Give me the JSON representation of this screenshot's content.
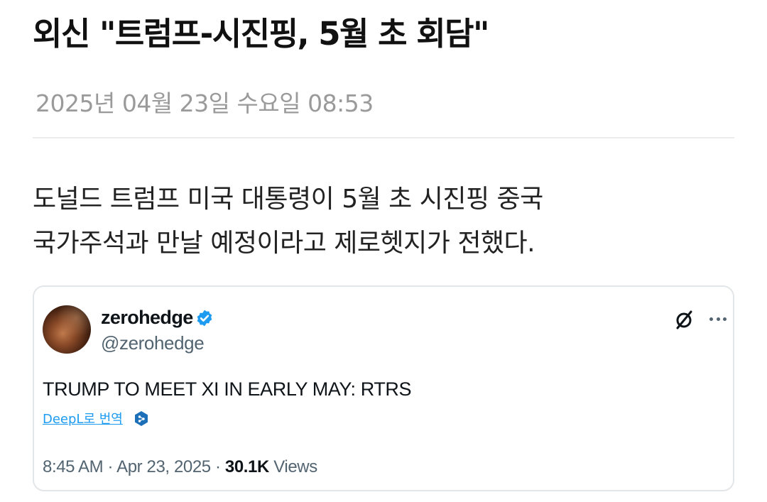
{
  "article": {
    "headline": "외신 \"트럼프-시진핑, 5월 초 회담\"",
    "dateline": "2025년 04월 23일 수요일 08:53",
    "body_line1": "도널드 트럼프 미국 대통령이 5월 초 시진핑 중국",
    "body_line2": "국가주석과 만날 예정이라고 제로헷지가 전했다."
  },
  "tweet": {
    "display_name": "zerohedge",
    "handle": "@zerohedge",
    "text": "TRUMP TO MEET XI IN EARLY MAY: RTRS",
    "translate_label": "DeepL로 번역",
    "time": "8:45 AM",
    "separator1": "·",
    "date": "Apr 23, 2025",
    "separator2": "·",
    "views_count": "30.1K",
    "views_label": "Views",
    "icons": {
      "verified": "verified-badge-icon",
      "logo": "x-logo-icon",
      "more": "more-options-icon",
      "deepl": "deepl-icon"
    },
    "colors": {
      "verified_blue": "#1d9bf0",
      "link_blue": "#1d9bf0",
      "meta_gray": "#536471"
    }
  }
}
